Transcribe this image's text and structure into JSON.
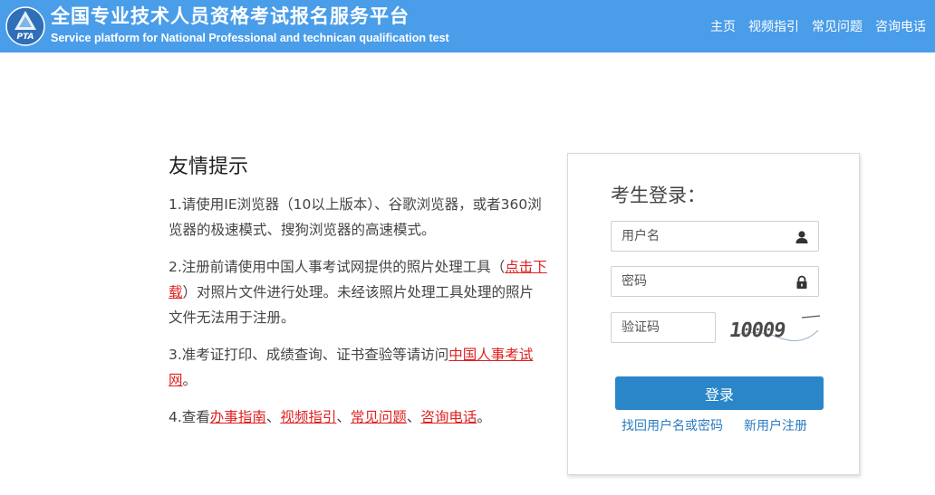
{
  "header": {
    "title_cn": "全国专业技术人员资格考试报名服务平台",
    "title_en": "Service platform for National Professional and technican qualification test",
    "logo_text": "PTA",
    "nav": [
      "主页",
      "视频指引",
      "常见问题",
      "咨询电话"
    ]
  },
  "tips": {
    "title": "友情提示",
    "tip1": "1.请使用IE浏览器（10以上版本）、谷歌浏览器，或者360浏览器的极速模式、搜狗浏览器的高速模式。",
    "tip2_pre": "2.注册前请使用中国人事考试网提供的照片处理工具（",
    "tip2_link": "点击下载",
    "tip2_post": "）对照片文件进行处理。未经该照片处理工具处理的照片文件无法用于注册。",
    "tip3_pre": "3.准考证打印、成绩查询、证书查验等请访问",
    "tip3_link": "中国人事考试网",
    "tip3_post": "。",
    "tip4_pre": "4.查看",
    "tip4_links": [
      "办事指南",
      "视频指引",
      "常见问题",
      "咨询电话"
    ],
    "tip4_sep": "、",
    "tip4_post": "。"
  },
  "login": {
    "title": "考生登录：",
    "username_placeholder": "用户名",
    "password_placeholder": "密码",
    "captcha_placeholder": "验证码",
    "captcha_text": "10009",
    "submit_label": "登录",
    "forgot_link": "找回用户名或密码",
    "register_link": "新用户注册"
  },
  "colors": {
    "header_bg": "#4a9de9",
    "button_bg": "#2a86c8",
    "link_red": "#e02020",
    "link_blue": "#2a7bc0"
  }
}
